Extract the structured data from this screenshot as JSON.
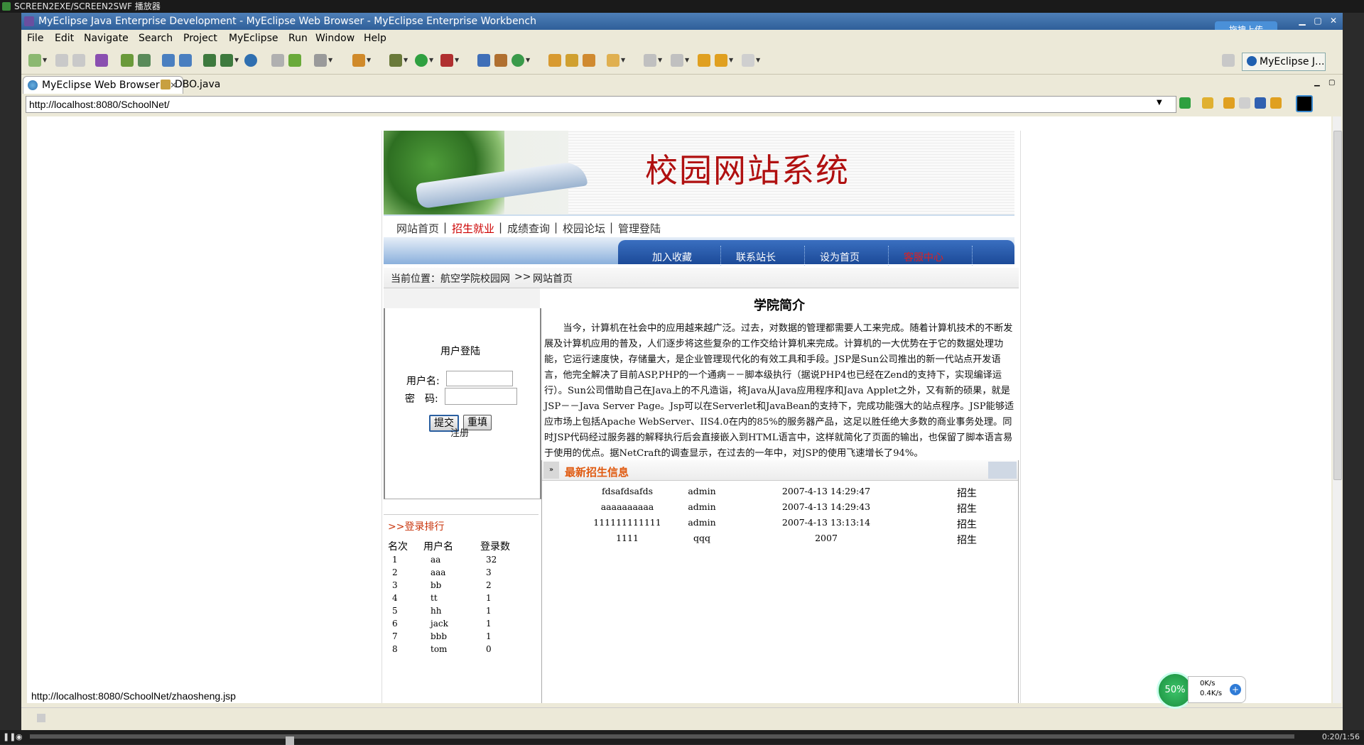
{
  "player": {
    "title": "SCREEN2EXE/SCREEN2SWF 播放器",
    "time": "0:20/1:56"
  },
  "window": {
    "title": "MyEclipse Java Enterprise Development - MyEclipse Web Browser - MyEclipse Enterprise Workbench",
    "upload_label": "拖拽上传"
  },
  "menu": [
    "File",
    "Edit",
    "Navigate",
    "Search",
    "Project",
    "MyEclipse",
    "Run",
    "Window",
    "Help"
  ],
  "perspective": {
    "label": "MyEclipse J..."
  },
  "tabs": [
    {
      "label": "MyEclipse Web Browser",
      "close": "✕"
    },
    {
      "label": "DBO.java"
    }
  ],
  "browser": {
    "url": "http://localhost:8080/SchoolNet/",
    "status_url": "http://localhost:8080/SchoolNet/zhaosheng.jsp"
  },
  "site": {
    "title": "校园网站系统",
    "nav": [
      "网站首页",
      "招生就业",
      "成绩查询",
      "校园论坛",
      "管理登陆"
    ],
    "nav_sep": "|",
    "subnav": [
      "加入收藏",
      "联系站长",
      "设为首页",
      "客服中心"
    ],
    "breadcrumb": {
      "prefix": "当前位置：",
      "home": "航空学院校园网",
      "sep": ">>",
      "current": "网站首页"
    },
    "login": {
      "title": "用户登陆",
      "username_label": "用户名:",
      "password_label": "密　码:",
      "submit": "提交",
      "reset": "重填",
      "register": "注册"
    },
    "ranking": {
      "title": ">>登录排行",
      "headers": [
        "名次",
        "用户名",
        "登录数"
      ],
      "rows": [
        [
          "1",
          "aa",
          "32"
        ],
        [
          "2",
          "aaa",
          "3"
        ],
        [
          "3",
          "bb",
          "2"
        ],
        [
          "4",
          "tt",
          "1"
        ],
        [
          "5",
          "hh",
          "1"
        ],
        [
          "6",
          "jack",
          "1"
        ],
        [
          "7",
          "bbb",
          "1"
        ],
        [
          "8",
          "tom",
          "0"
        ]
      ]
    },
    "intro": {
      "title": "学院简介",
      "text": "当今，计算机在社会中的应用越来越广泛。过去，对数据的管理都需要人工来完成。随着计算机技术的不断发展及计算机应用的普及，人们逐步将这些复杂的工作交给计算机来完成。计算机的一大优势在于它的数据处理功能，它运行速度快，存储量大，是企业管理现代化的有效工具和手段。JSP是Sun公司推出的新一代站点开发语言，他完全解决了目前ASP,PHP的一个通病－－脚本级执行（据说PHP4也已经在Zend的支持下，实现编译运行）。Sun公司借助自己在Java上的不凡造诣，将Java从Java应用程序和Java Applet之外，又有新的硕果，就是JSP－－Java Server Page。Jsp可以在Serverlet和JavaBean的支持下，完成功能强大的站点程序。JSP能够适应市场上包括Apache WebServer、IIS4.0在内的85%的服务器产品，这足以胜任绝大多数的商业事务处理。同时JSP代码经过服务器的解释执行后会直接嵌入到HTML语言中，这样就简化了页面的输出，也保留了脚本语言易于使用的优点。据NetCraft的调查显示，在过去的一年中，对JSP的使用飞速增长了94%。"
    },
    "news": {
      "title": "最新招生信息",
      "rows": [
        [
          "fdsafdsafds",
          "admin",
          "2007-4-13 14:29:47",
          "招生"
        ],
        [
          "aaaaaaaaaa",
          "admin",
          "2007-4-13 14:29:43",
          "招生"
        ],
        [
          "111111111111",
          "admin",
          "2007-4-13 13:13:14",
          "招生"
        ],
        [
          "1111",
          "qqq",
          "2007",
          "招生"
        ]
      ]
    }
  },
  "speed": {
    "percent": "50%",
    "up": "0K/s",
    "down": "0.4K/s",
    "plus": "+"
  }
}
